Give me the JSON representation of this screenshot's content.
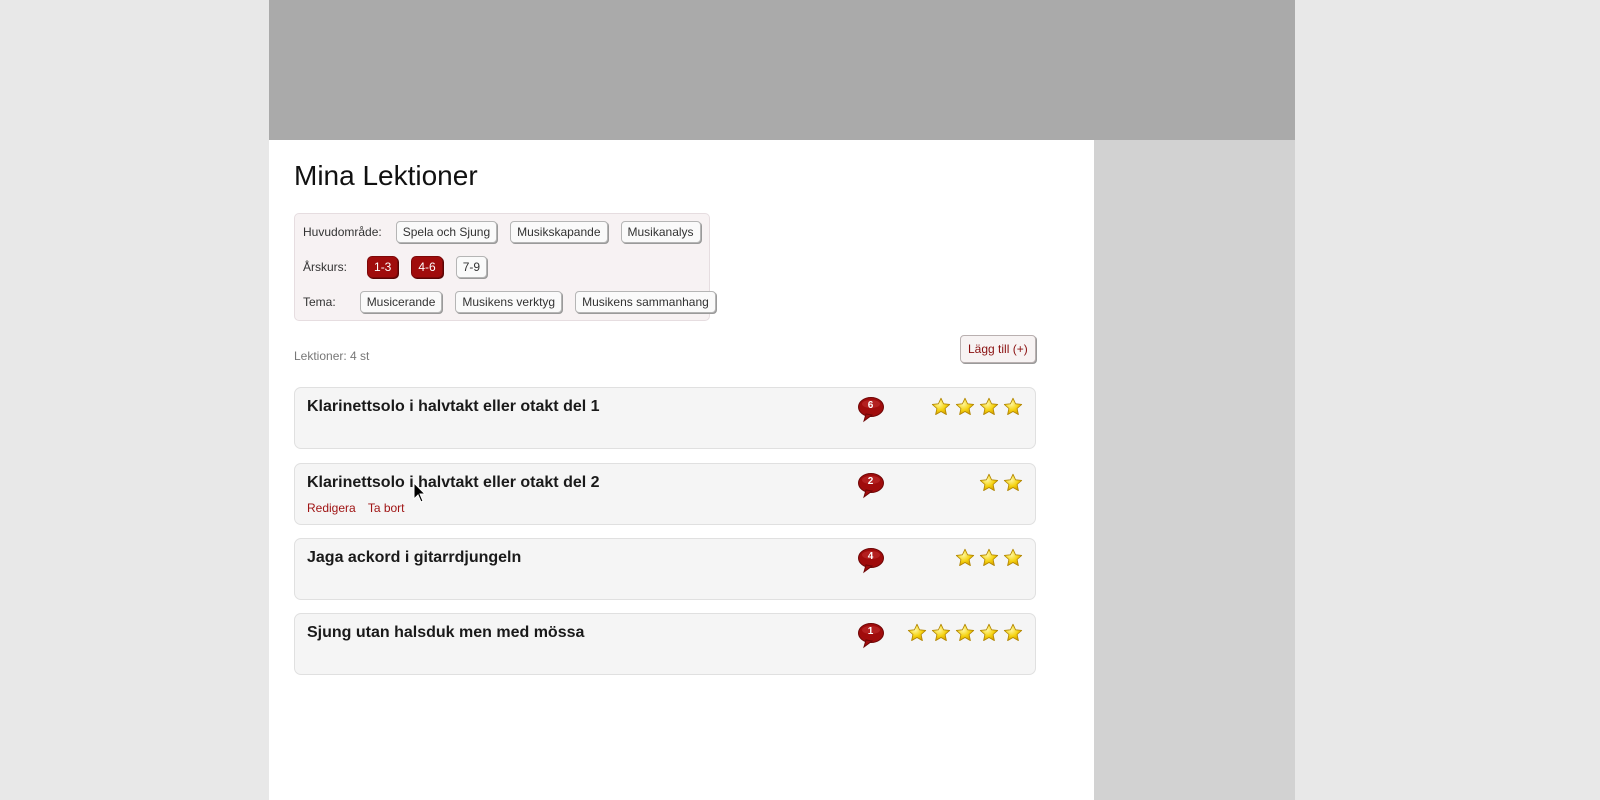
{
  "page": {
    "title": "Mina Lektioner"
  },
  "filters": {
    "area": {
      "label": "Huvudområde:",
      "options": [
        {
          "label": "Spela och Sjung",
          "active": false
        },
        {
          "label": "Musikskapande",
          "active": false
        },
        {
          "label": "Musikanalys",
          "active": false
        }
      ]
    },
    "grade": {
      "label": "Årskurs:",
      "options": [
        {
          "label": "1-3",
          "active": true
        },
        {
          "label": "4-6",
          "active": true
        },
        {
          "label": "7-9",
          "active": false
        }
      ]
    },
    "theme": {
      "label": "Tema:",
      "options": [
        {
          "label": "Musicerande",
          "active": false
        },
        {
          "label": "Musikens verktyg",
          "active": false
        },
        {
          "label": "Musikens sammanhang",
          "active": false
        }
      ]
    }
  },
  "lessons_summary": {
    "count_label": "Lektioner: 4 st",
    "add_label": "Lägg till (+)"
  },
  "lessons": [
    {
      "title": "Klarinettsolo i halvtakt eller otakt del 1",
      "comments": "6",
      "stars": 4,
      "actions": []
    },
    {
      "title": "Klarinettsolo i halvtakt eller otakt del 2",
      "comments": "2",
      "stars": 2,
      "actions": [
        "Redigera",
        "Ta bort"
      ]
    },
    {
      "title": "Jaga ackord i gitarrdjungeln",
      "comments": "4",
      "stars": 3,
      "actions": []
    },
    {
      "title": "Sjung utan halsduk men med mössa",
      "comments": "1",
      "stars": 5,
      "actions": []
    }
  ],
  "colors": {
    "accent": "#a00c0c",
    "header_banner": "#aaaaaa",
    "sidebar": "#d2d2d2",
    "star": "#f5d20f"
  },
  "icons": {
    "comment": "comment-bubble-icon",
    "rating": "star-icon",
    "pointer": "mouse-cursor-icon"
  }
}
